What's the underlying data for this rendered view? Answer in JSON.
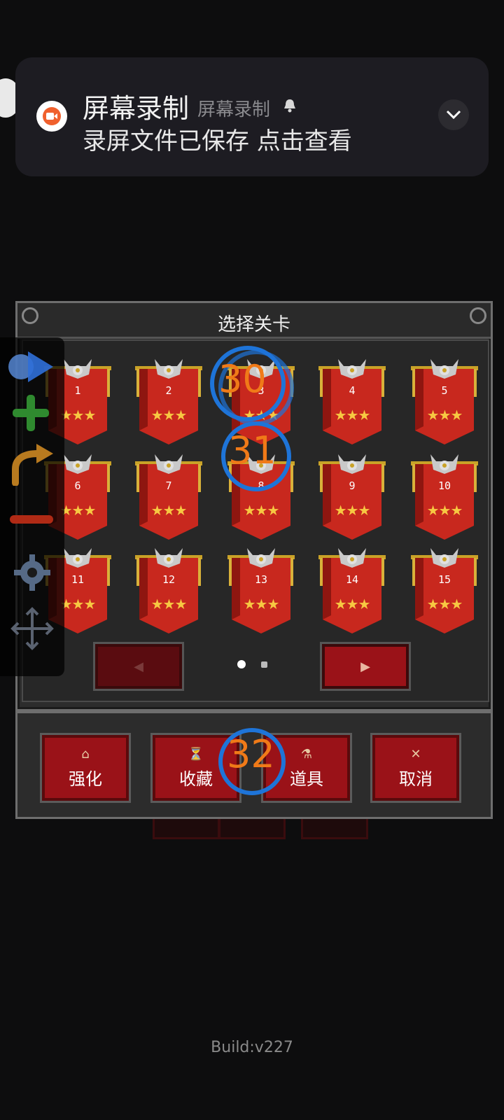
{
  "notification": {
    "title": "屏幕录制",
    "app_name": "屏幕录制",
    "body": "录屏文件已保存 点击查看",
    "icon": "video-camera-icon",
    "accent": "#f0602d"
  },
  "dialog": {
    "title": "选择关卡",
    "levels": [
      {
        "num": "1",
        "stars": "★★★"
      },
      {
        "num": "2",
        "stars": "★★★"
      },
      {
        "num": "3",
        "stars": "★★★"
      },
      {
        "num": "4",
        "stars": "★★★"
      },
      {
        "num": "5",
        "stars": "★★★"
      },
      {
        "num": "6",
        "stars": "★★★"
      },
      {
        "num": "7",
        "stars": "★★★"
      },
      {
        "num": "8",
        "stars": "★★★"
      },
      {
        "num": "9",
        "stars": "★★★"
      },
      {
        "num": "10",
        "stars": "★★★"
      },
      {
        "num": "11",
        "stars": "★★★"
      },
      {
        "num": "12",
        "stars": "★★★"
      },
      {
        "num": "13",
        "stars": "★★★"
      },
      {
        "num": "14",
        "stars": "★★★"
      },
      {
        "num": "15",
        "stars": "★★★"
      }
    ],
    "prev_label": "◀",
    "next_label": "▶",
    "page_current": 1,
    "page_total": 2
  },
  "actions": [
    {
      "label": "强化",
      "icon": "upgrade-icon"
    },
    {
      "label": "收藏",
      "icon": "trophy-icon"
    },
    {
      "label": "道具",
      "icon": "potion-icon"
    },
    {
      "label": "取消",
      "icon": "cross-icon"
    }
  ],
  "touch_markers": {
    "a": "30",
    "b": "31",
    "c": "32"
  },
  "build": "Build:v227",
  "colors": {
    "banner_red": "#c8281e",
    "star": "#f7c842",
    "touch_ring": "#1e74d8",
    "touch_number": "#f07a18"
  }
}
